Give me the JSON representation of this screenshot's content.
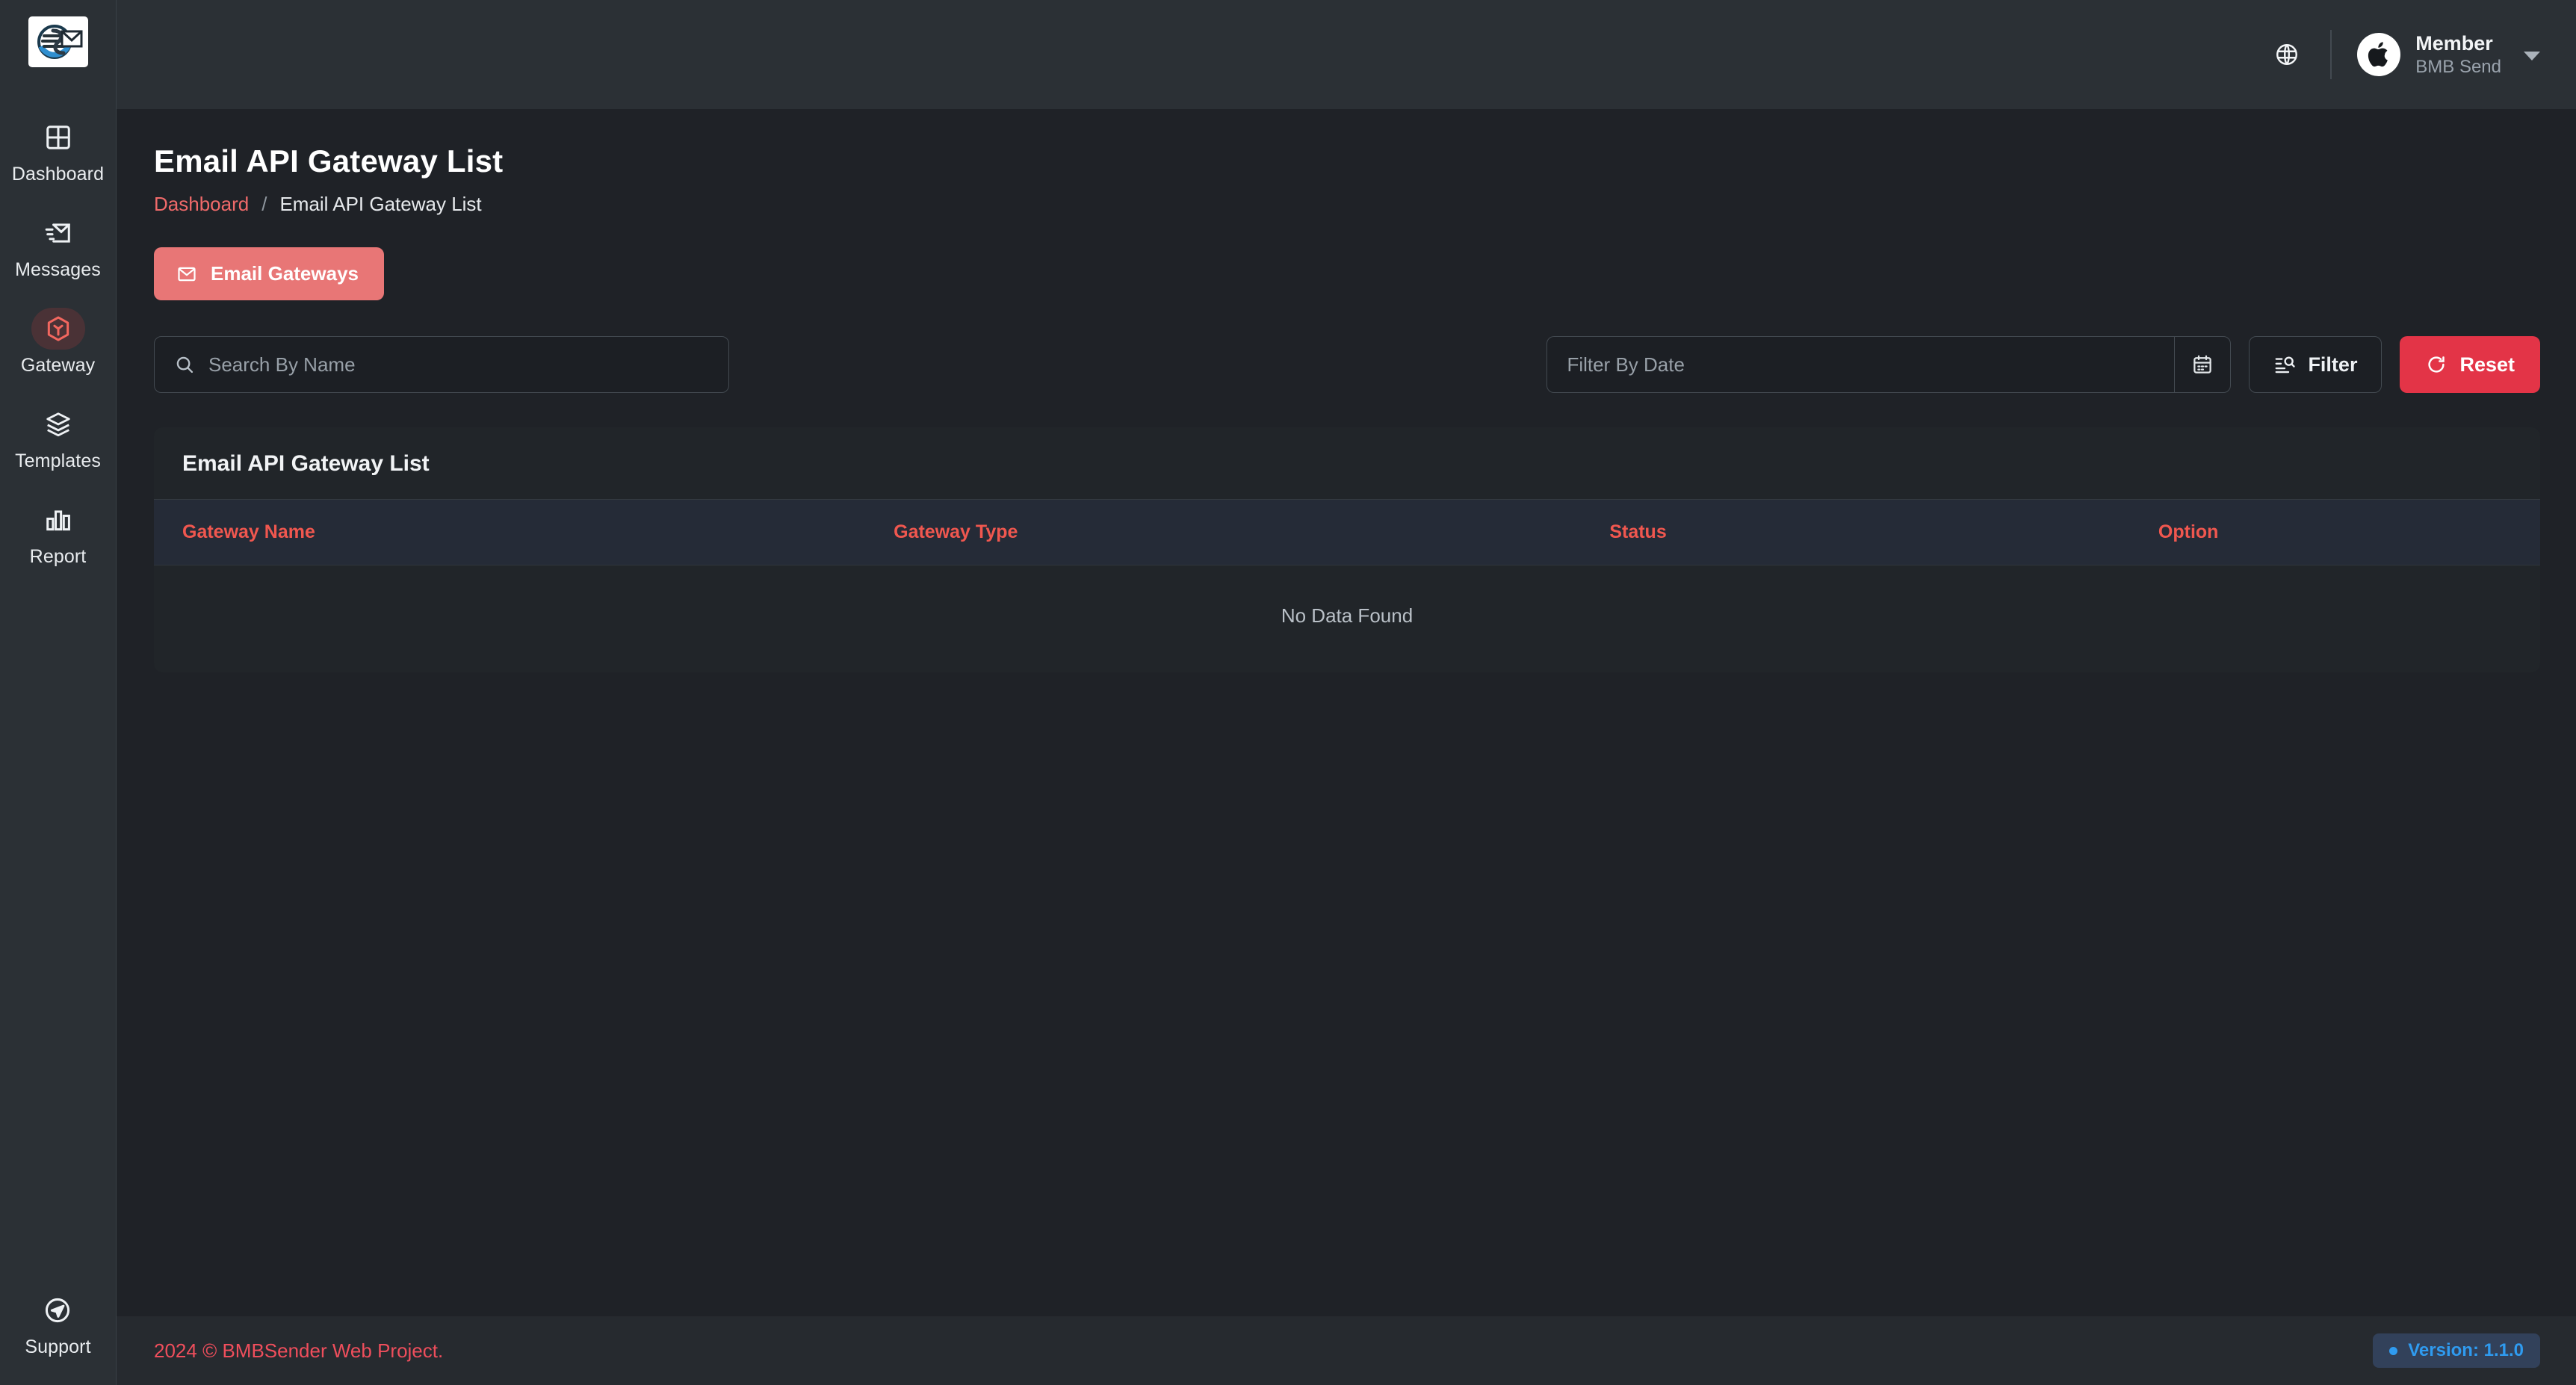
{
  "brand": {
    "logo_alt": "BMBSender logo"
  },
  "sidebar": {
    "items": [
      {
        "label": "Dashboard",
        "icon": "dashboard-grid-icon",
        "active": false
      },
      {
        "label": "Messages",
        "icon": "message-envelope-icon",
        "active": false
      },
      {
        "label": "Gateway",
        "icon": "gateway-hexagon-icon",
        "active": true
      },
      {
        "label": "Templates",
        "icon": "templates-layers-icon",
        "active": false
      },
      {
        "label": "Report",
        "icon": "report-bar-chart-icon",
        "active": false
      }
    ],
    "support": {
      "label": "Support",
      "icon": "support-send-icon"
    }
  },
  "topbar": {
    "globe_icon": "globe-icon",
    "user": {
      "name": "Member",
      "org": "BMB Send",
      "avatar_icon": "apple-logo-icon"
    }
  },
  "page": {
    "title": "Email API Gateway List",
    "breadcrumb": {
      "root": "Dashboard",
      "separator": "/",
      "current": "Email API Gateway List"
    },
    "primary_button": {
      "label": "Email Gateways",
      "icon": "mail-icon"
    }
  },
  "filters": {
    "search": {
      "placeholder": "Search By Name",
      "value": "",
      "icon": "search-icon"
    },
    "date": {
      "placeholder": "Filter By Date",
      "value": "",
      "icon": "calendar-icon"
    },
    "filter_button": {
      "label": "Filter",
      "icon": "filter-list-search-icon"
    },
    "reset_button": {
      "label": "Reset",
      "icon": "reset-refresh-icon"
    }
  },
  "table": {
    "title": "Email API Gateway List",
    "columns": [
      "Gateway Name",
      "Gateway Type",
      "Status",
      "Option"
    ],
    "rows": [],
    "empty_message": "No Data Found"
  },
  "footer": {
    "copyright": "2024 © BMBSender Web Project.",
    "version": "Version: 1.1.0"
  },
  "colors": {
    "accent_red": "#f06a6a",
    "danger_red": "#e33447",
    "table_header_red": "#f0574f",
    "version_blue": "#2f9bf0",
    "sidebar_bg": "#2b3035",
    "content_bg": "#1f2227",
    "card_bg": "#212529"
  }
}
